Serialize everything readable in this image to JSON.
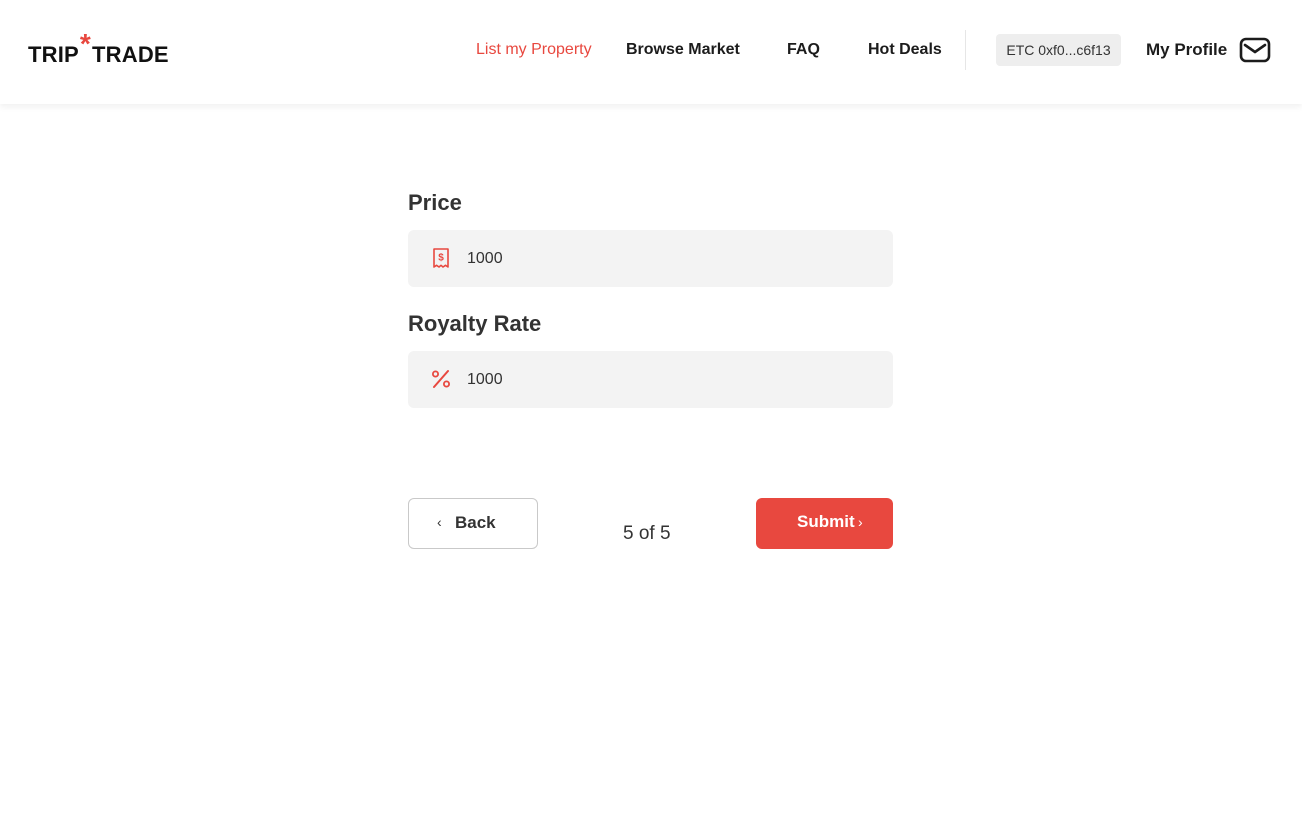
{
  "brand": {
    "logo_left": "TRIP",
    "logo_star": "*",
    "logo_right": "TRADE",
    "accent_color": "#e8483f"
  },
  "nav": {
    "items": [
      {
        "label": "List my Property",
        "active": true
      },
      {
        "label": "Browse Market",
        "active": false
      },
      {
        "label": "FAQ",
        "active": false
      },
      {
        "label": "Hot Deals",
        "active": false
      }
    ],
    "wallet": "ETC 0xf0...c6f13",
    "profile": "My Profile",
    "mail_icon": "mail-icon"
  },
  "form": {
    "price": {
      "label": "Price",
      "value": "1000",
      "icon": "receipt-dollar-icon"
    },
    "royalty": {
      "label": "Royalty Rate",
      "value": "1000",
      "icon": "percent-icon"
    }
  },
  "footer": {
    "back_chevron": "‹",
    "back_label": "Back",
    "step": "5 of 5",
    "submit_label": "Submit",
    "submit_chevron": "›"
  }
}
